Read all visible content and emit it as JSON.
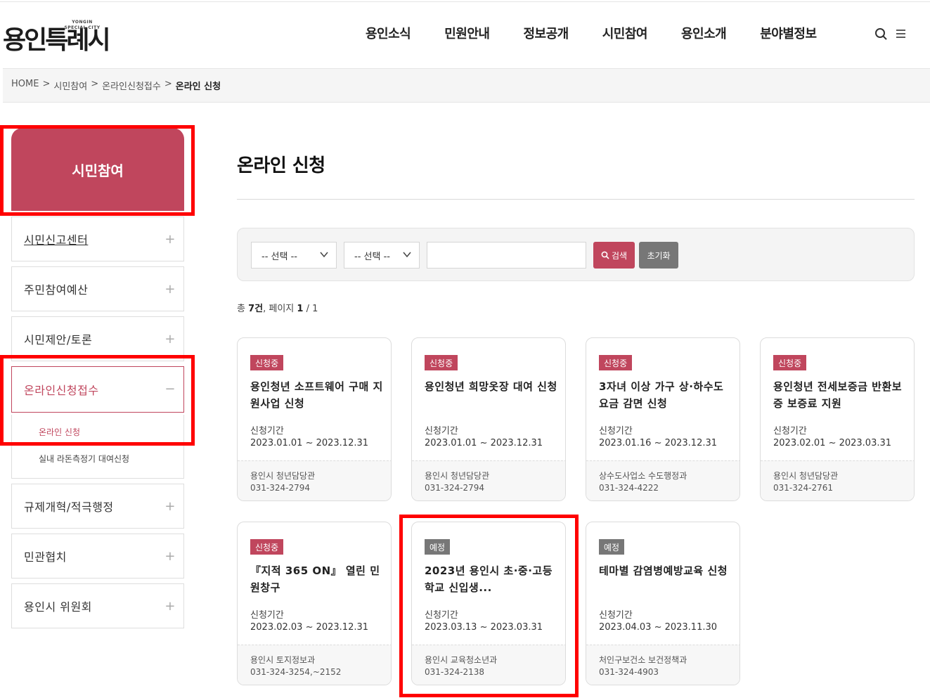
{
  "header": {
    "logo_text": "용인특례시",
    "logo_english": "YONGIN SPECIAL CITY",
    "nav": [
      "용인소식",
      "민원안내",
      "정보공개",
      "시민참여",
      "용인소개",
      "분야별정보"
    ],
    "icons": [
      "search-icon",
      "menu-icon"
    ]
  },
  "breadcrumb": {
    "items": [
      "HOME",
      ">",
      "시민참여",
      ">",
      "온라인신청접수",
      ">"
    ],
    "current": "온라인 신청"
  },
  "sidebar": {
    "heading": "시민참여",
    "items": [
      {
        "label": "시민신고센터",
        "toggle": "+"
      },
      {
        "label": "주민참여예산",
        "toggle": "+"
      },
      {
        "label": "시민제안/토론",
        "toggle": "+"
      },
      {
        "label": "온라인신청접수",
        "toggle": "−"
      },
      {
        "label": "규제개혁/적극행정",
        "toggle": "+"
      },
      {
        "label": "민관협치",
        "toggle": "+"
      },
      {
        "label": "용인시 위원회",
        "toggle": "+"
      }
    ],
    "subitems": [
      "온라인 신청",
      "실내 라돈측정기 대여신청"
    ]
  },
  "main": {
    "title": "온라인 신청",
    "search": {
      "select1": "-- 선택 --",
      "select2": "-- 선택 --",
      "keyword_value": "",
      "search_label": "검색",
      "reset_label": "초기화"
    },
    "total": {
      "prefix": "총",
      "count": "7건",
      "page_label": ", 페이지",
      "page": "1",
      "sep": "/",
      "pages": "1"
    },
    "period_label": "신청기간",
    "cards": [
      {
        "status": "신청중",
        "title": "용인청년 소프트웨어 구매 지원사업 신청",
        "period": "2023.01.01 ~ 2023.12.31",
        "dept": "용인시 청년담당관",
        "tel": "031-324-2794"
      },
      {
        "status": "신청중",
        "title": "용인청년 희망옷장 대여 신청",
        "period": "2023.01.01 ~ 2023.12.31",
        "dept": "용인시 청년담당관",
        "tel": "031-324-2794"
      },
      {
        "status": "신청중",
        "title": "3자녀 이상 가구 상·하수도요금 감면 신청",
        "period": "2023.01.16 ~ 2023.12.31",
        "dept": "상수도사업소 수도행정과",
        "tel": "031-324-4222"
      },
      {
        "status": "신청중",
        "title": "용인청년 전세보증금 반환보증 보증료 지원",
        "period": "2023.02.01 ~ 2023.03.31",
        "dept": "용인시 청년담당관",
        "tel": "031-324-2761"
      },
      {
        "status": "신청중",
        "title": "『지적 365 ON』 열린 민원창구",
        "period": "2023.02.03 ~ 2023.12.31",
        "dept": "용인시 토지정보과",
        "tel": "031-324-3254,~2152"
      },
      {
        "status": "예정",
        "title": "2023년 용인시 초·중·고등학교 신입생...",
        "period": "2023.03.13 ~ 2023.03.31",
        "dept": "용인시 교육청소년과",
        "tel": "031-324-2138"
      },
      {
        "status": "예정",
        "title": "테마별 감염병예방교육 신청",
        "period": "2023.04.03 ~ 2023.11.30",
        "dept": "처인구보건소 보건정책과",
        "tel": "031-324-4903"
      }
    ]
  },
  "colors": {
    "accent": "#c0465d",
    "plan_badge": "#777777",
    "annotation": "#ff0000"
  }
}
